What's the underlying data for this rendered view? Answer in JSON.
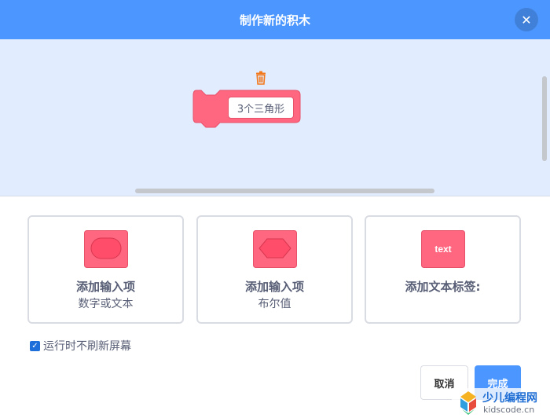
{
  "dialog": {
    "title": "制作新的积木",
    "close_icon": "close-icon"
  },
  "workspace": {
    "block_label": "3个三角形",
    "block_color": "#ff6680",
    "trash_icon": "trash-icon"
  },
  "options": [
    {
      "title": "添加输入项",
      "subtitle": "数字或文本",
      "icon": "round-input-icon"
    },
    {
      "title": "添加输入项",
      "subtitle": "布尔值",
      "icon": "boolean-input-icon"
    },
    {
      "title": "添加文本标签:",
      "subtitle": "",
      "icon": "text-label-icon",
      "icon_text": "text"
    }
  ],
  "run_without_refresh": {
    "label": "运行时不刷新屏幕",
    "checked": true
  },
  "buttons": {
    "cancel": "取消",
    "done": "完成"
  },
  "watermark": {
    "title": "少儿编程网",
    "url": "kidscode.cn"
  },
  "colors": {
    "header": "#4c97ff",
    "workspace_bg": "#e1ecff",
    "accent": "#4c97ff",
    "block": "#ff6680",
    "trash": "#f2781c"
  }
}
